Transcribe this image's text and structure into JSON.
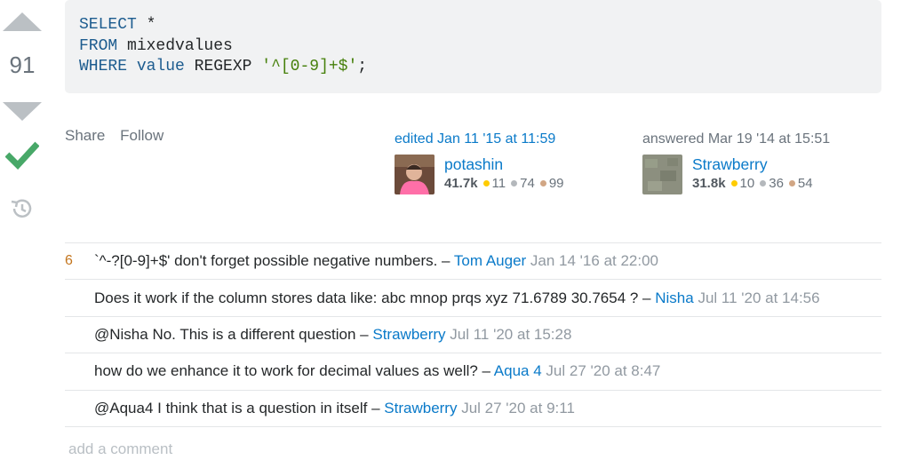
{
  "vote": {
    "count": "91"
  },
  "code": {
    "line1": {
      "kw": "SELECT",
      "rest": " *"
    },
    "line2": {
      "kw": "FROM",
      "rest": " mixedvalues"
    },
    "line3": {
      "kw1": "WHERE",
      "kw2": "value",
      "mid": " REGEXP ",
      "str": "'^[0-9]+$'",
      "end": ";"
    }
  },
  "actions": {
    "share": "Share",
    "follow": "Follow"
  },
  "edited": {
    "label": "edited Jan 11 '15 at 11:59",
    "user": "potashin",
    "rep": "41.7k",
    "gold": "11",
    "silver": "74",
    "bronze": "99"
  },
  "answered": {
    "label": "answered Mar 19 '14 at 15:51",
    "user": "Strawberry",
    "rep": "31.8k",
    "gold": "10",
    "silver": "36",
    "bronze": "54"
  },
  "comments": [
    {
      "score": "6",
      "text": "`^-?[0-9]+$' don't forget possible negative numbers. – ",
      "user": "Tom Auger",
      "date": "Jan 14 '16 at 22:00"
    },
    {
      "score": "",
      "text": "Does it work if the column stores data like: abc mnop prqs xyz 71.6789 30.7654 ? – ",
      "user": "Nisha",
      "date": "Jul 11 '20 at 14:56"
    },
    {
      "score": "",
      "text": "@Nisha No. This is a different question – ",
      "user": "Strawberry",
      "date": "Jul 11 '20 at 15:28"
    },
    {
      "score": "",
      "text": "how do we enhance it to work for decimal values as well? – ",
      "user": "Aqua 4",
      "date": "Jul 27 '20 at 8:47"
    },
    {
      "score": "",
      "text": "@Aqua4 I think that is a question in itself – ",
      "user": "Strawberry",
      "date": "Jul 27 '20 at 9:11"
    }
  ],
  "add_comment": "add a comment",
  "colors": {
    "accent": "#0a7ac9",
    "accepted": "#48a868",
    "code_bg": "#f1f2f3"
  }
}
